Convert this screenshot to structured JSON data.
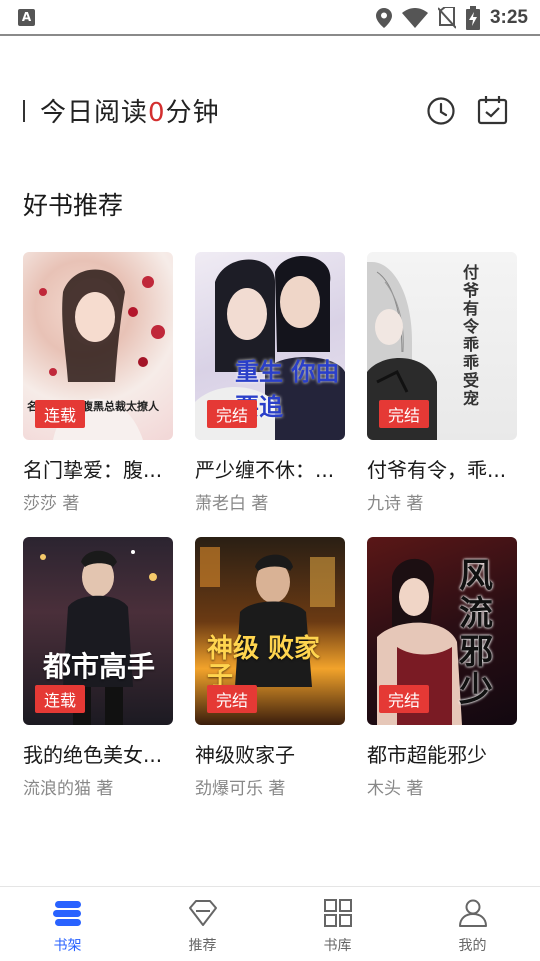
{
  "status_bar": {
    "time": "3:25",
    "left_icon": "A",
    "icons": [
      "location-icon",
      "wifi-icon",
      "no-sim-icon",
      "battery-charging-icon"
    ]
  },
  "reading": {
    "prefix": "今日阅读",
    "minutes": "0",
    "suffix": "分钟",
    "minutes_color": "#d32f2f"
  },
  "section": {
    "title": "好书推荐"
  },
  "books": [
    {
      "title": "名门挚爱：腹...",
      "author": "莎莎 著",
      "status": "连载",
      "cover_text": "名门挚爱：腹黑总裁太撩人"
    },
    {
      "title": "严少缠不休：...",
      "author": "萧老白 著",
      "status": "完结",
      "cover_text": "重生 你由要追"
    },
    {
      "title": "付爷有令，乖...",
      "author": "九诗 著",
      "status": "完结",
      "cover_text": "付爷有令 乖乖受宠"
    },
    {
      "title": "我的绝色美女...",
      "author": "流浪的猫 著",
      "status": "连载",
      "cover_text": "都市高手"
    },
    {
      "title": "神级败家子",
      "author": "劲爆可乐 著",
      "status": "完结",
      "cover_text": "神级 败家子"
    },
    {
      "title": "都市超能邪少",
      "author": "木头 著",
      "status": "完结",
      "cover_text": "风流邪少"
    }
  ],
  "nav": {
    "items": [
      {
        "label": "书架",
        "icon": "bookshelf-icon",
        "active": true
      },
      {
        "label": "推荐",
        "icon": "diamond-icon",
        "active": false
      },
      {
        "label": "书库",
        "icon": "grid-icon",
        "active": false
      },
      {
        "label": "我的",
        "icon": "person-icon",
        "active": false
      }
    ],
    "active_color": "#2962ff"
  }
}
